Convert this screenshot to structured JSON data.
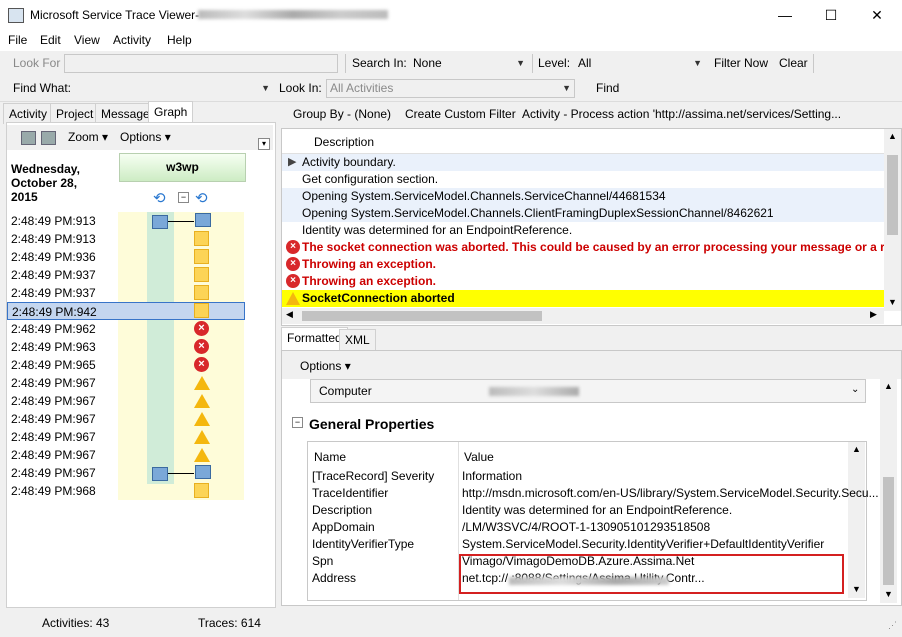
{
  "window": {
    "title": "Microsoft Service Trace Viewer-",
    "minimize": "—",
    "maximize": "☐",
    "close": "✕"
  },
  "menu": [
    "File",
    "Edit",
    "View",
    "Activity",
    "Help"
  ],
  "toolbar1": {
    "look_for": "Look For",
    "search_in_label": "Search In:",
    "search_in_value": "None",
    "level_label": "Level:",
    "level_value": "All",
    "filter_now": "Filter Now",
    "clear": "Clear"
  },
  "toolbar2": {
    "find_what": "Find What:",
    "look_in_label": "Look In:",
    "look_in_value": "All Activities",
    "find": "Find"
  },
  "left_tabs": [
    "Activity",
    "Project",
    "Message",
    "Graph"
  ],
  "graph_toolbar": {
    "zoom": "Zoom",
    "options": "Options"
  },
  "graph": {
    "date": [
      "Wednesday,",
      "October 28,",
      "2015"
    ],
    "process": "w3wp",
    "rows": [
      {
        "time": "2:48:49 PM:913",
        "event": "node"
      },
      {
        "time": "2:48:49 PM:913",
        "event": "square"
      },
      {
        "time": "2:48:49 PM:936",
        "event": "square"
      },
      {
        "time": "2:48:49 PM:937",
        "event": "square"
      },
      {
        "time": "2:48:49 PM:937",
        "event": "square"
      },
      {
        "time": "2:48:49 PM:942",
        "event": "square",
        "selected": true
      },
      {
        "time": "2:48:49 PM:962",
        "event": "error"
      },
      {
        "time": "2:48:49 PM:963",
        "event": "error"
      },
      {
        "time": "2:48:49 PM:965",
        "event": "error"
      },
      {
        "time": "2:48:49 PM:967",
        "event": "warning"
      },
      {
        "time": "2:48:49 PM:967",
        "event": "warning"
      },
      {
        "time": "2:48:49 PM:967",
        "event": "warning"
      },
      {
        "time": "2:48:49 PM:967",
        "event": "warning"
      },
      {
        "time": "2:48:49 PM:967",
        "event": "warning"
      },
      {
        "time": "2:48:49 PM:967",
        "event": "node"
      },
      {
        "time": "2:48:49 PM:968",
        "event": "square"
      }
    ]
  },
  "right_toolbar": {
    "group_by": "Group By - (None)",
    "create_filter": "Create Custom Filter",
    "activity": "Activity - Process action 'http://assima.net/services/Setting..."
  },
  "description": {
    "header": "Description",
    "rows": [
      {
        "text": "Activity boundary.",
        "kind": "arrow",
        "alt": true
      },
      {
        "text": "Get configuration section.",
        "kind": "plain",
        "alt": false
      },
      {
        "text": "Opening System.ServiceModel.Channels.ServiceChannel/44681534",
        "kind": "plain",
        "alt": true
      },
      {
        "text": "Opening System.ServiceModel.Channels.ClientFramingDuplexSessionChannel/8462621",
        "kind": "plain",
        "alt": true
      },
      {
        "text": "Identity was determined for an EndpointReference.",
        "kind": "plain",
        "alt": false
      },
      {
        "text": "The socket connection was aborted. This could be caused by an error processing your message or a r",
        "kind": "error",
        "alt": false
      },
      {
        "text": "Throwing an exception.",
        "kind": "error",
        "alt": false
      },
      {
        "text": "Throwing an exception.",
        "kind": "error",
        "alt": false
      },
      {
        "text": "SocketConnection aborted",
        "kind": "warning",
        "alt": false
      }
    ]
  },
  "detail_tabs": [
    "Formatted",
    "XML"
  ],
  "detail": {
    "options": "Options",
    "computer_label": "Computer",
    "section_title": "General Properties",
    "col_name": "Name",
    "col_value": "Value",
    "properties": [
      {
        "name": "[TraceRecord] Severity",
        "value": "Information"
      },
      {
        "name": "TraceIdentifier",
        "value": "http://msdn.microsoft.com/en-US/library/System.ServiceModel.Security.Secu..."
      },
      {
        "name": "Description",
        "value": "Identity was determined for an EndpointReference."
      },
      {
        "name": "AppDomain",
        "value": "/LM/W3SVC/4/ROOT-1-130905101293518508"
      },
      {
        "name": "IdentityVerifierType",
        "value": "System.ServiceModel.Security.IdentityVerifier+DefaultIdentityVerifier"
      },
      {
        "name": "Spn",
        "value": "Vimago/VimagoDemoDB.Azure.Assima.Net"
      },
      {
        "name": "Address",
        "value": "net.tcp://                              :8088/Settings/Assima.Utility.Contr..."
      }
    ]
  },
  "status": {
    "activities": "Activities: 43",
    "traces": "Traces: 614"
  },
  "colors": {
    "error": "#cc0000",
    "warning_bg": "#ffff00",
    "selection": "#c4d6ef",
    "highlight_box": "#d42020"
  }
}
